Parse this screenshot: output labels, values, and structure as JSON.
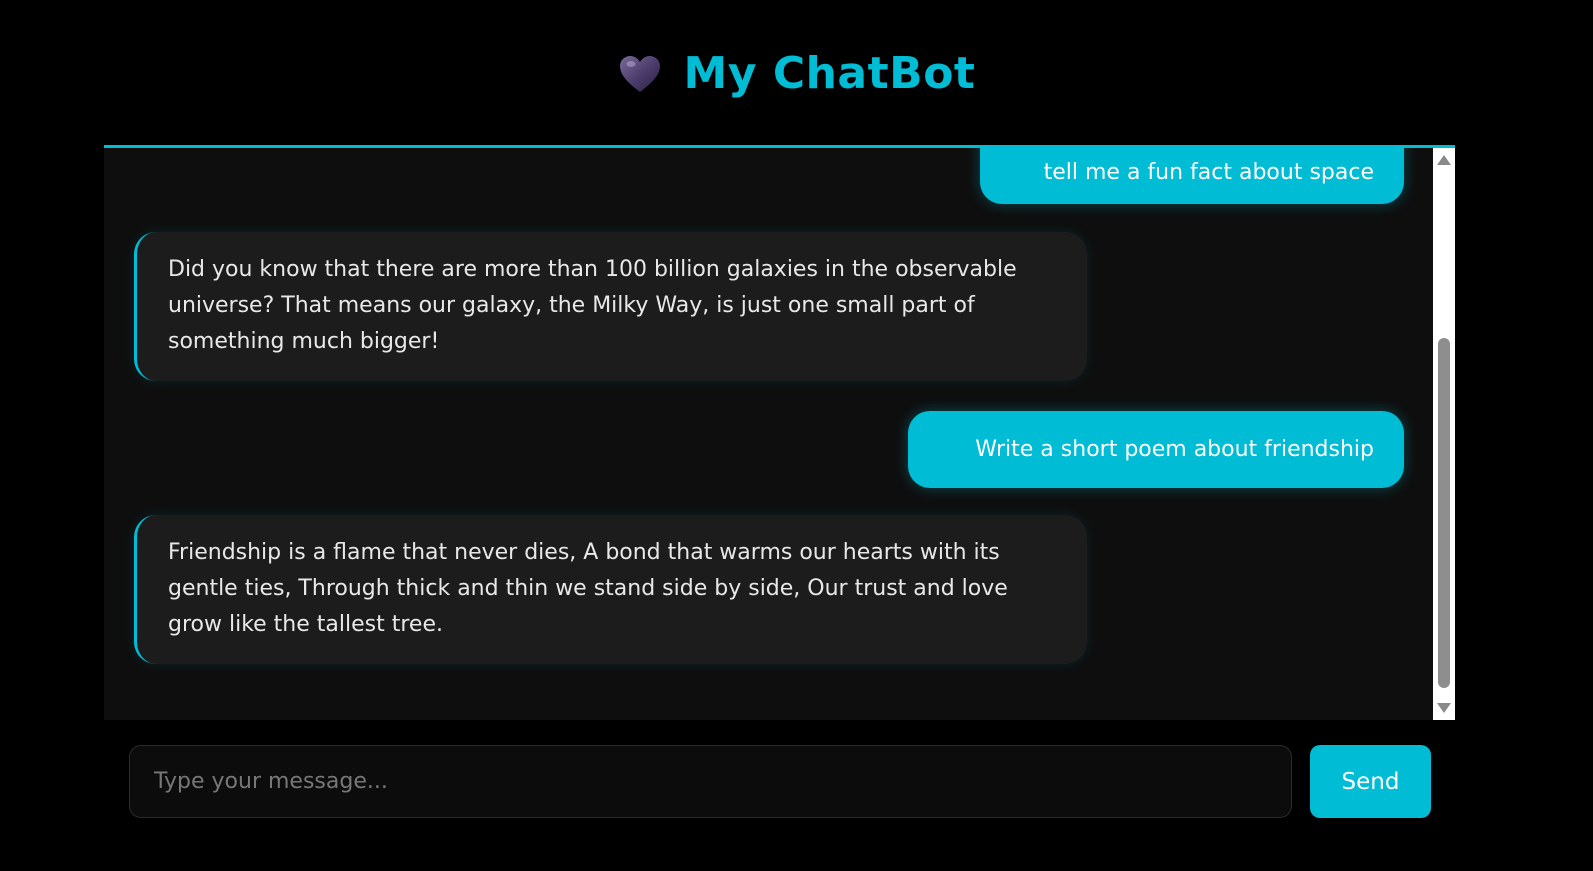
{
  "header": {
    "icon": "heart-icon",
    "title": "My ChatBot"
  },
  "colors": {
    "accent": "#00bcd4",
    "page_background": "#000000",
    "panel_background": "#0e0e0e",
    "bot_bubble_background": "#1c1c1c"
  },
  "messages": [
    {
      "role": "user",
      "text": "tell me a fun fact about space"
    },
    {
      "role": "bot",
      "text": "Did you know that there are more than 100 billion galaxies in the observable universe? That means our galaxy, the Milky Way, is just one small part of something much bigger!"
    },
    {
      "role": "user",
      "text": "Write a short poem about friendship"
    },
    {
      "role": "bot",
      "text": "Friendship is a flame that never dies, A bond that warms our hearts with its gentle ties, Through thick and thin we stand side by side, Our trust and love grow like the tallest tree."
    }
  ],
  "composer": {
    "value": "",
    "placeholder": "Type your message...",
    "send_label": "Send"
  }
}
